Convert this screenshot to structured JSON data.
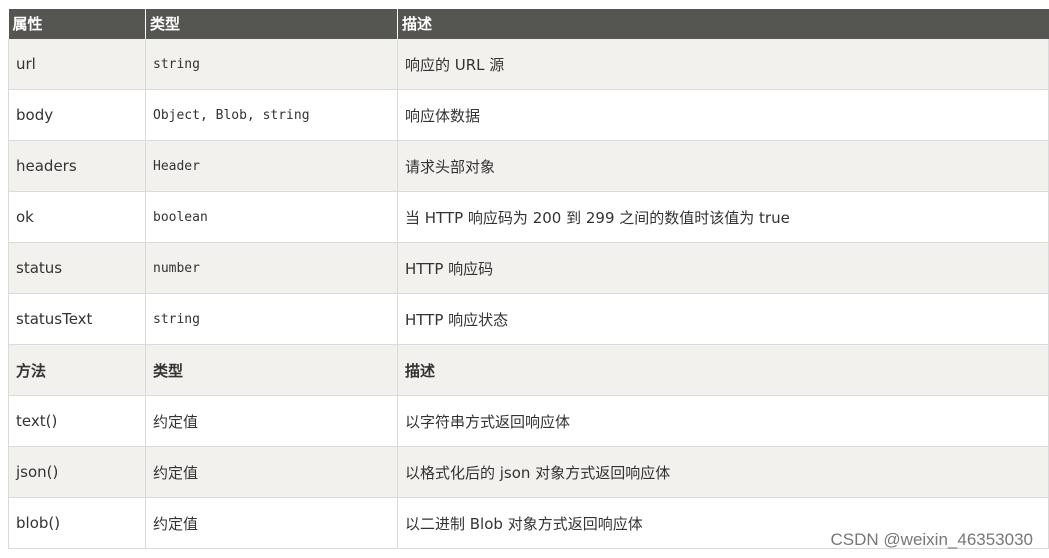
{
  "header": [
    "属性",
    "类型",
    "描述"
  ],
  "rows": [
    {
      "cells": [
        "url",
        "string",
        "响应的 URL 源"
      ],
      "mono": true
    },
    {
      "cells": [
        "body",
        "Object, Blob, string",
        "响应体数据"
      ],
      "mono": true
    },
    {
      "cells": [
        "headers",
        "Header",
        "请求头部对象"
      ],
      "mono": true
    },
    {
      "cells": [
        "ok",
        "boolean",
        "当 HTTP 响应码为 200 到 299 之间的数值时该值为 true"
      ],
      "mono": true
    },
    {
      "cells": [
        "status",
        "number",
        "HTTP 响应码"
      ],
      "mono": true
    },
    {
      "cells": [
        "statusText",
        "string",
        "HTTP 响应状态"
      ],
      "mono": true
    },
    {
      "cells": [
        "方法",
        "类型",
        "描述"
      ],
      "sub": true
    },
    {
      "cells": [
        "text()",
        "约定值",
        "以字符串方式返回响应体"
      ]
    },
    {
      "cells": [
        "json()",
        "约定值",
        "以格式化后的 json 对象方式返回响应体"
      ]
    },
    {
      "cells": [
        "blob()",
        "约定值",
        "以二进制 Blob 对象方式返回响应体"
      ]
    }
  ],
  "watermark": "CSDN @weixin_46353030"
}
